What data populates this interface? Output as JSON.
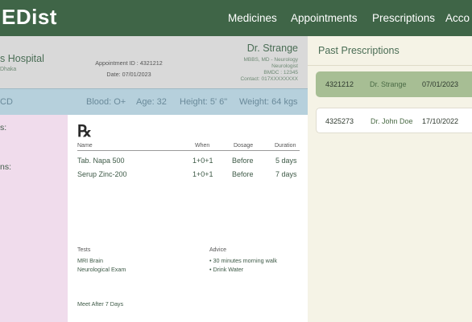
{
  "app": {
    "logo": "EDist"
  },
  "nav": [
    "Medicines",
    "Appointments",
    "Prescriptions",
    "Acco"
  ],
  "header": {
    "hospital_name": "s Hospital",
    "hospital_location": "Dhaka",
    "appointment_id": "Appointment ID : 4321212",
    "date": "Date: 07/01/2023",
    "doctor_name": "Dr. Strange",
    "doctor_lines": [
      "MBBS, MD - Neurology",
      "Neurologist",
      "BMDC : 12345",
      "Contact: 017XXXXXXXX"
    ]
  },
  "vitals": {
    "partial": "CD",
    "blood": "Blood: O+",
    "age": "Age: 32",
    "height": "Height: 5' 6\"",
    "weight": "Weight: 64 kgs"
  },
  "side": [
    "s:",
    "ns:"
  ],
  "rx": {
    "symbol": "℞",
    "headers": {
      "name": "Name",
      "when": "When",
      "dosage": "Dosage",
      "duration": "Duration"
    },
    "medicines": [
      {
        "name": "Tab. Napa 500",
        "when": "1+0+1",
        "dosage": "Before",
        "duration": "5 days"
      },
      {
        "name": "Serup Zinc-200",
        "when": "1+0+1",
        "dosage": "Before",
        "duration": "7 days"
      }
    ],
    "tests_label": "Tests",
    "tests": [
      "MRI Brain",
      "Neurological Exam"
    ],
    "advice_label": "Advice",
    "advice": [
      "• 30 minutes morning walk",
      "• Drink Water"
    ],
    "followup": "Meet After 7 Days"
  },
  "past": {
    "title": "Past Prescriptions",
    "items": [
      {
        "id": "4321212",
        "doctor": "Dr. Strange",
        "date": "07/01/2023",
        "selected": true
      },
      {
        "id": "4325273",
        "doctor": "Dr. John Doe",
        "date": "17/10/2022",
        "selected": false
      }
    ]
  },
  "colors": {
    "topbar": "#3f6547",
    "vitals": "#b6d0dc",
    "pink": "#f0dcec",
    "selected_card": "#a7be94",
    "panel": "#f5f3e6"
  }
}
